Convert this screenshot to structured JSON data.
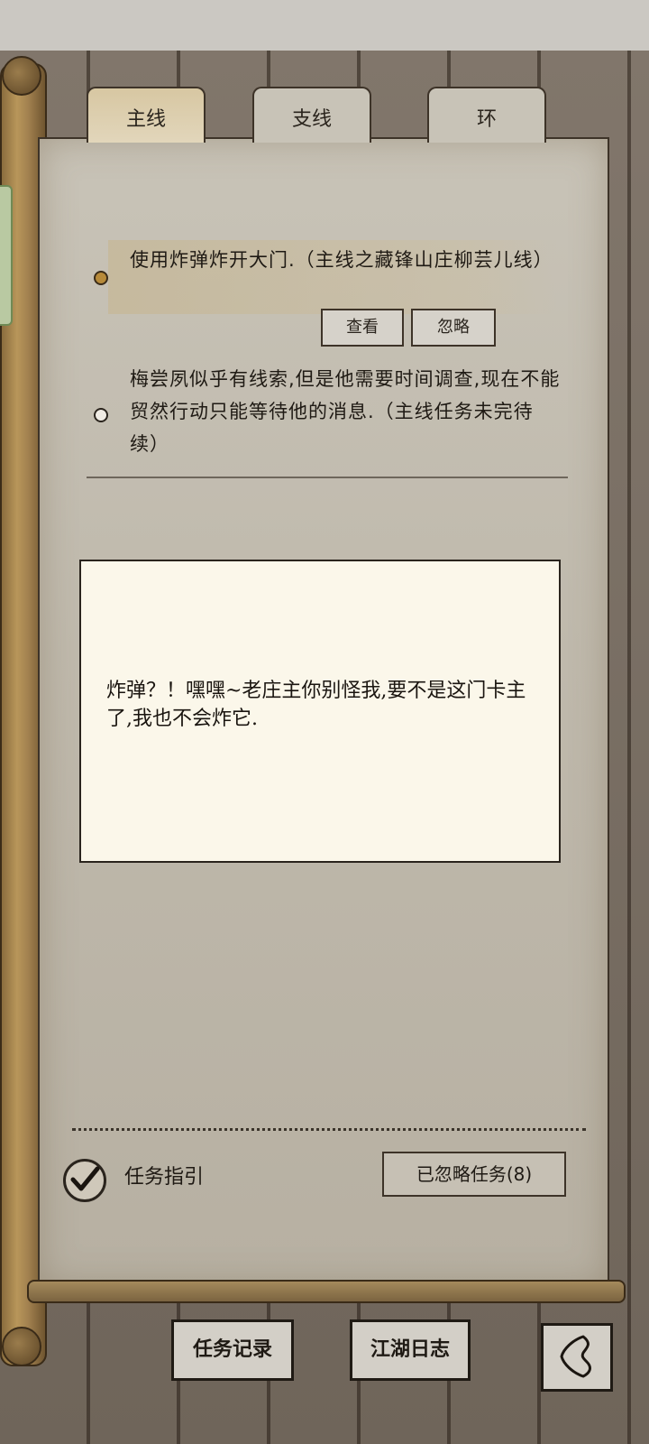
{
  "tabs": [
    {
      "label": "主线",
      "active": true
    },
    {
      "label": "支线",
      "active": false
    },
    {
      "label": "环",
      "active": false
    }
  ],
  "tasks": [
    {
      "text": "使用炸弹炸开大门.（主线之藏锋山庄柳芸儿线）",
      "highlighted": true
    },
    {
      "text": "梅尝夙似乎有线索,但是他需要时间调查,现在不能贸然行动只能等待他的消息.（主线任务未完待续）",
      "highlighted": false
    }
  ],
  "task_actions": {
    "view": "查看",
    "ignore": "忽略"
  },
  "dialog": {
    "text": "炸弹？！嘿嘿~老庄主你别怪我,要不是这门卡主了,我也不会炸它."
  },
  "guide": {
    "label": "任务指引",
    "checked": true
  },
  "ignored_tasks_button": "已忽略任务(8)",
  "bottom_nav": {
    "task_record": "任务记录",
    "jianghu_log": "江湖日志"
  },
  "icons": {
    "back": "back-arrow-icon",
    "check": "checkmark-icon"
  },
  "colors": {
    "paper": "#c8c3b7",
    "dialog_bg": "#fbf7ea",
    "active_dot": "#b78a3a"
  }
}
